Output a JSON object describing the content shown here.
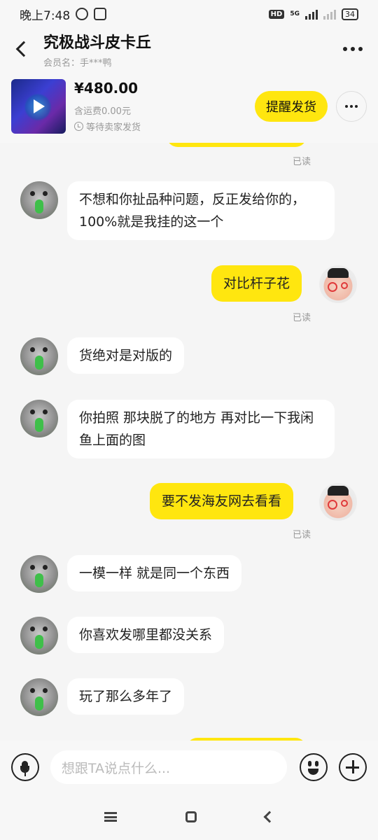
{
  "status": {
    "time": "晚上7:48",
    "network": "5G",
    "hd": "HD",
    "battery": "34"
  },
  "header": {
    "title": "究极战斗皮卡丘",
    "member": "会员名：手***鸭"
  },
  "product": {
    "price": "¥480.00",
    "shipping": "含运费0.00元",
    "status": "等待卖家发货",
    "remind_label": "提醒发货"
  },
  "messages": [
    {
      "side": "left",
      "text": "不想和你扯品种问题，反正发给你的，100%就是我挂的这一个"
    },
    {
      "side": "right",
      "text": "对比杆子花",
      "read": "已读"
    },
    {
      "side": "left",
      "text": "货绝对是对版的"
    },
    {
      "side": "left",
      "text": "你拍照 那块脱了的地方 再对比一下我闲鱼上面的图"
    },
    {
      "side": "right",
      "text": "要不发海友网去看看",
      "read": "已读"
    },
    {
      "side": "left",
      "text": "一模一样 就是同一个东西"
    },
    {
      "side": "left",
      "text": "你喜欢发哪里都没关系"
    },
    {
      "side": "left",
      "text": "玩了那么多年了"
    }
  ],
  "top_read": "已读",
  "input": {
    "placeholder": "想跟TA说点什么..."
  },
  "colors": {
    "accent": "#ffe60f",
    "background": "#f5f5f5",
    "bubble_left": "#ffffff"
  }
}
